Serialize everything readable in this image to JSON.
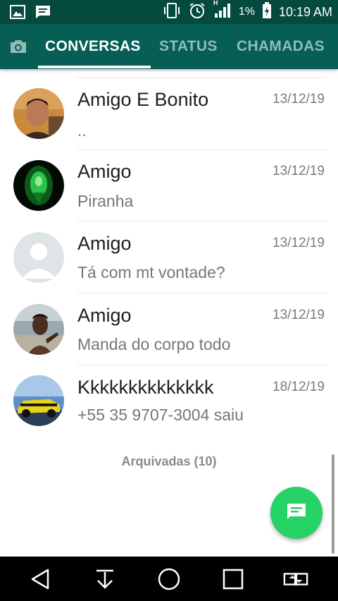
{
  "status_bar": {
    "icons": [
      "image-icon",
      "message-icon",
      "vibrate-icon",
      "alarm-icon",
      "signal-icon",
      "battery-charging-icon"
    ],
    "network": "H",
    "battery": "1%",
    "time": "10:19 AM"
  },
  "app_bar": {
    "camera_icon": "camera-icon",
    "tabs": [
      {
        "label": "CONVERSAS",
        "active": true
      },
      {
        "label": "STATUS",
        "active": false
      },
      {
        "label": "CHAMADAS",
        "active": false
      }
    ]
  },
  "chats": [
    {
      "name": "Amigo E Bonito",
      "date": "13/12/19",
      "message": ".."
    },
    {
      "name": "Amigo",
      "date": "13/12/19",
      "message": "Piranha"
    },
    {
      "name": "Amigo",
      "date": "13/12/19",
      "message": "Tá com mt vontade?"
    },
    {
      "name": "Amigo",
      "date": "13/12/19",
      "message": "Manda do corpo todo"
    },
    {
      "name": "Kkkkkkkkkkkkkk",
      "date": "18/12/19",
      "message": "+55 35 9707-3004 saiu"
    }
  ],
  "archived": "Arquivadas (10)",
  "fab_icon": "new-chat-icon",
  "colors": {
    "status_bar": "#044a3f",
    "app_bar": "#075e54",
    "fab": "#25d366"
  },
  "nav_bar": {
    "icons": [
      "back-icon",
      "download-icon",
      "home-icon",
      "recents-icon",
      "switch-app-icon"
    ]
  }
}
